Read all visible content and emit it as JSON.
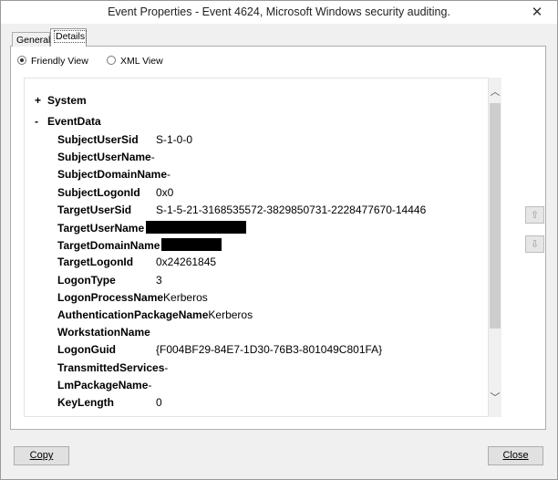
{
  "window": {
    "title": "Event Properties - Event 4624, Microsoft Windows security auditing.",
    "close_glyph": "✕"
  },
  "tabs": [
    {
      "label": "General",
      "selected": false
    },
    {
      "label": "Details",
      "selected": true
    }
  ],
  "view_options": [
    {
      "label": "Friendly View",
      "checked": true
    },
    {
      "label": "XML View",
      "checked": false
    }
  ],
  "tree": {
    "system": {
      "sign": "+",
      "label": "System"
    },
    "eventdata": {
      "sign": "-",
      "label": "EventData"
    },
    "rows": [
      {
        "key": "SubjectUserSid",
        "value": "S-1-0-0"
      },
      {
        "key": "SubjectUserName",
        "value": "-"
      },
      {
        "key": "SubjectDomainName",
        "value": "-"
      },
      {
        "key": "SubjectLogonId",
        "value": "0x0"
      },
      {
        "key": "TargetUserSid",
        "value": "S-1-5-21-3168535572-3829850731-2228477670-14446"
      },
      {
        "key": "TargetUserName",
        "value": "",
        "redacted": true
      },
      {
        "key": "TargetDomainName",
        "value": "",
        "redacted": true
      },
      {
        "key": "TargetLogonId",
        "value": "0x24261845"
      },
      {
        "key": "LogonType",
        "value": "3"
      },
      {
        "key": "LogonProcessName",
        "value": "Kerberos"
      },
      {
        "key": "AuthenticationPackageName",
        "value": "Kerberos"
      },
      {
        "key": "WorkstationName",
        "value": ""
      },
      {
        "key": "LogonGuid",
        "value": "{F004BF29-84E7-1D30-76B3-801049C801FA}"
      },
      {
        "key": "TransmittedServices",
        "value": "-"
      },
      {
        "key": "LmPackageName",
        "value": "-"
      },
      {
        "key": "KeyLength",
        "value": "0"
      }
    ]
  },
  "scrollbar": {
    "up_glyph": "︿",
    "down_glyph": "﹀"
  },
  "side_buttons": {
    "up_glyph": "⇧",
    "down_glyph": "⇩"
  },
  "buttons": {
    "copy": "Copy",
    "close": "Close"
  },
  "colors": {
    "redaction": "#000000",
    "window_bg": "#f0f0f0"
  }
}
